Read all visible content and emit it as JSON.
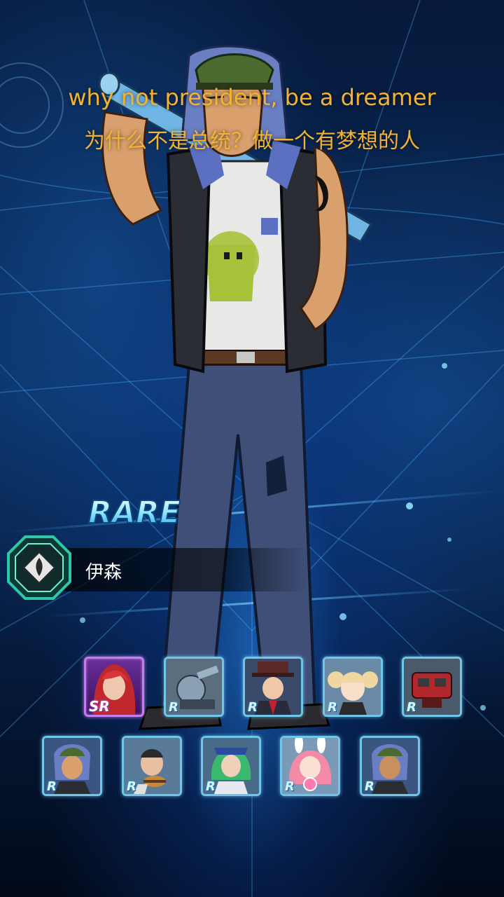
{
  "quote": {
    "english": "why not president, be a dreamer",
    "chinese": "为什么不是总统？做一个有梦想的人"
  },
  "character": {
    "name": "伊森",
    "rarity_label": "RARE"
  },
  "roster": {
    "row1": [
      {
        "grade": "SR",
        "portrait": "red-haired-woman"
      },
      {
        "grade": "R",
        "portrait": "mech-turret"
      },
      {
        "grade": "R",
        "portrait": "top-hat-man"
      },
      {
        "grade": "R",
        "portrait": "blonde-girl"
      },
      {
        "grade": "R",
        "portrait": "red-cannon"
      }
    ],
    "row2": [
      {
        "grade": "R",
        "portrait": "capped-man"
      },
      {
        "grade": "R",
        "portrait": "burger-man"
      },
      {
        "grade": "R",
        "portrait": "green-hair-officer"
      },
      {
        "grade": "R",
        "portrait": "pink-bunny-girl"
      },
      {
        "grade": "R",
        "portrait": "capped-man-alt"
      }
    ]
  },
  "colors": {
    "quote": "#f2b233",
    "card_border_r": "#6fc6e8",
    "card_border_sr": "#c47cf0",
    "emblem": "#2ec8a8"
  }
}
